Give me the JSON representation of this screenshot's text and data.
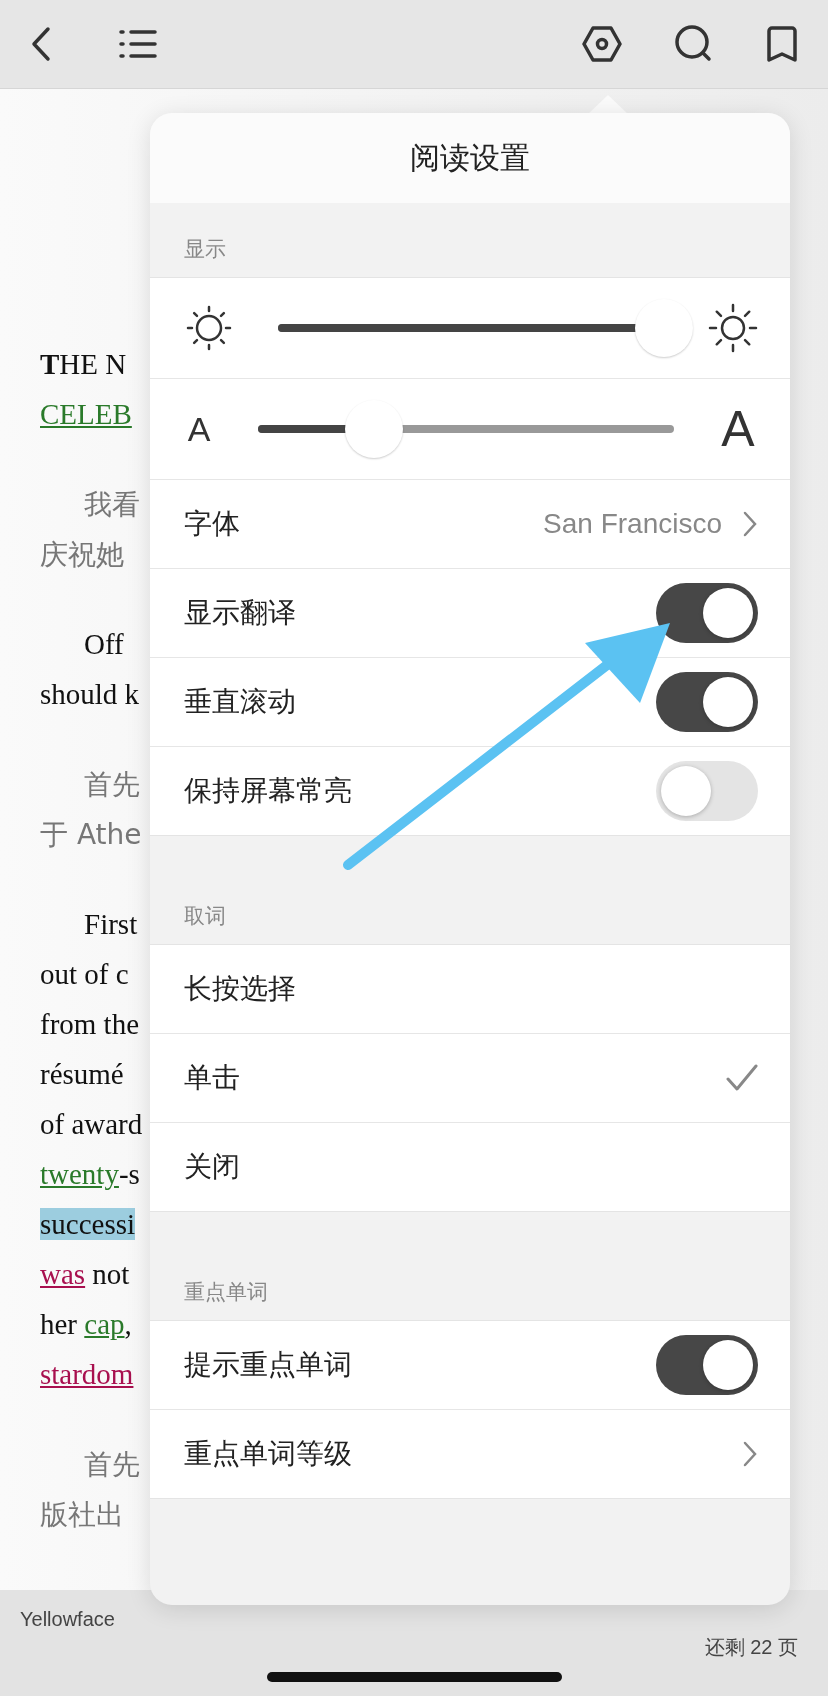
{
  "book": {
    "lines": [
      {
        "segments": [
          {
            "kind": "plain",
            "text": "**T**HE N"
          }
        ]
      },
      {
        "segments": [
          {
            "kind": "link-green",
            "text": "CELEB"
          }
        ]
      },
      {
        "segments": [
          {
            "kind": "chinese-indent",
            "text": "我看"
          }
        ]
      },
      {
        "segments": [
          {
            "kind": "chinese",
            "text": "庆祝她"
          }
        ]
      },
      {
        "segments": [
          {
            "kind": "indent",
            "text": "Off"
          }
        ]
      },
      {
        "segments": [
          {
            "kind": "plain",
            "text": "should k"
          }
        ]
      },
      {
        "segments": [
          {
            "kind": "chinese-indent",
            "text": "首先"
          }
        ]
      },
      {
        "segments": [
          {
            "kind": "chinese",
            "text": "于 Athe"
          }
        ]
      },
      {
        "segments": [
          {
            "kind": "indent",
            "text": "First"
          }
        ]
      },
      {
        "segments": [
          {
            "kind": "plain",
            "text": "out of c"
          }
        ]
      },
      {
        "segments": [
          {
            "kind": "plain",
            "text": "from the"
          }
        ]
      },
      {
        "segments": [
          {
            "kind": "plain",
            "text": "résumé"
          }
        ]
      },
      {
        "segments": [
          {
            "kind": "plain",
            "text": "of award"
          }
        ]
      },
      {
        "segments": [
          {
            "kind": "link-green",
            "text": "twenty"
          },
          {
            "kind": "plain",
            "text": "-s"
          }
        ]
      },
      {
        "segments": [
          {
            "kind": "highlight",
            "text": "successi"
          }
        ]
      },
      {
        "segments": [
          {
            "kind": "link-red",
            "text": "was"
          },
          {
            "kind": "plain",
            "text": " not"
          }
        ]
      },
      {
        "segments": [
          {
            "kind": "plain",
            "text": "her "
          },
          {
            "kind": "link-green",
            "text": "cap"
          },
          {
            "kind": "plain",
            "text": ","
          }
        ]
      },
      {
        "segments": [
          {
            "kind": "link-red",
            "text": "stardom"
          }
        ]
      },
      {
        "segments": [
          {
            "kind": "chinese-indent",
            "text": "首先"
          }
        ]
      },
      {
        "segments": [
          {
            "kind": "chinese",
            "text": "版社出"
          }
        ]
      }
    ]
  },
  "status_bar": {
    "title": "Yellowface",
    "pages_left": "还剩 22 页"
  },
  "settings": {
    "title": "阅读设置",
    "sections": [
      {
        "header": "显示",
        "rows": [
          {
            "kind": "slider",
            "level": 1
          },
          {
            "kind": "slider",
            "min_label": "A",
            "max_label": "A",
            "level": 0.28
          },
          {
            "kind": "select",
            "label": "字体",
            "value": "San Francisco"
          },
          {
            "kind": "toggle",
            "label": "显示翻译",
            "on": true
          },
          {
            "kind": "toggle",
            "label": "垂直滚动",
            "on": true
          },
          {
            "kind": "toggle",
            "label": "保持屏幕常亮",
            "on": false
          }
        ]
      },
      {
        "header": "取词",
        "rows": [
          {
            "kind": "choice",
            "label": "长按选择",
            "selected": false
          },
          {
            "kind": "choice",
            "label": "单击",
            "selected": true
          },
          {
            "kind": "choice",
            "label": "关闭",
            "selected": false
          }
        ]
      },
      {
        "header": "重点单词",
        "rows": [
          {
            "kind": "toggle",
            "label": "提示重点单词",
            "on": true
          },
          {
            "kind": "link",
            "label": "重点单词等级"
          }
        ]
      }
    ]
  }
}
